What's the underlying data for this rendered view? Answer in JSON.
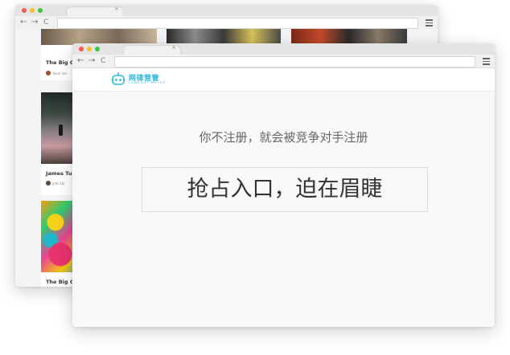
{
  "back_window": {
    "tab_close": "×",
    "nav": {
      "back": "←",
      "forward": "→",
      "reload": "C"
    },
    "cards": [
      {
        "title": "The Big C",
        "author": "Yanni Val"
      },
      {
        "title": "James Tu",
        "author": "John Do"
      },
      {
        "title": "The Big C",
        "author": ""
      }
    ]
  },
  "front_window": {
    "tab_close": "×",
    "nav": {
      "back": "←",
      "forward": "→",
      "reload": "C"
    },
    "logo": {
      "text": "网律营管",
      "subtitle": "LAWSHOP·MYTOP"
    },
    "subtitle": "你不注册，就会被竞争对手注册",
    "headline": "抢占入口，迫在眉睫"
  },
  "colors": {
    "accent": "#27b8e0",
    "traffic_red": "#f25c55",
    "traffic_yellow": "#f6be2e",
    "traffic_green": "#3fc63f"
  }
}
